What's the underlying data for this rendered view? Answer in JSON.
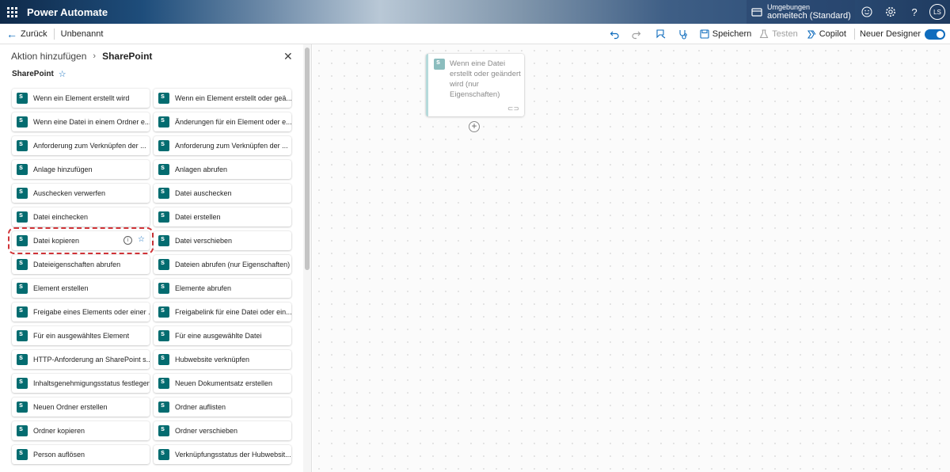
{
  "header": {
    "app_name": "Power Automate",
    "env_label": "Umgebungen",
    "env_value": "aomeitech (Standard)",
    "avatar_initials": "LS",
    "icons": [
      "waffle-icon",
      "environment-icon",
      "smiley-icon",
      "settings-icon",
      "help-icon"
    ]
  },
  "commandbar": {
    "back_label": "Zurück",
    "flow_name": "Unbenannt",
    "save_label": "Speichern",
    "test_label": "Testen",
    "copilot_label": "Copilot",
    "new_designer_label": "Neuer Designer"
  },
  "panel": {
    "crumb": "Aktion hinzufügen",
    "current": "SharePoint",
    "connector_title": "SharePoint",
    "actions": [
      "Wenn ein Element erstellt wird",
      "Wenn ein Element erstellt oder geä...",
      "Wenn eine Datei in einem Ordner e...",
      "Änderungen für ein Element oder e...",
      "Anforderung zum Verknüpfen der ...",
      "Anforderung zum Verknüpfen der ...",
      "Anlage hinzufügen",
      "Anlagen abrufen",
      "Auschecken verwerfen",
      "Datei auschecken",
      "Datei einchecken",
      "Datei erstellen",
      "Datei kopieren",
      "Datei verschieben",
      "Dateieigenschaften abrufen",
      "Dateien abrufen (nur Eigenschaften)",
      "Element erstellen",
      "Elemente abrufen",
      "Freigabe eines Elements oder einer ...",
      "Freigabelink für eine Datei oder ein...",
      "Für ein ausgewähltes Element",
      "Für eine ausgewählte Datei",
      "HTTP-Anforderung an SharePoint s...",
      "Hubwebsite verknüpfen",
      "Inhaltsgenehmigungsstatus festlegen",
      "Neuen Dokumentsatz erstellen",
      "Neuen Ordner erstellen",
      "Ordner auflisten",
      "Ordner kopieren",
      "Ordner verschieben",
      "Person auflösen",
      "Verknüpfungsstatus der Hubwebsit..."
    ]
  },
  "canvas": {
    "trigger_text": "Wenn eine Datei erstellt oder geändert wird (nur Eigenschaften)"
  },
  "colors": {
    "accent": "#0f6cbd",
    "sharepoint": "#036c70",
    "selection": "#d13438"
  }
}
